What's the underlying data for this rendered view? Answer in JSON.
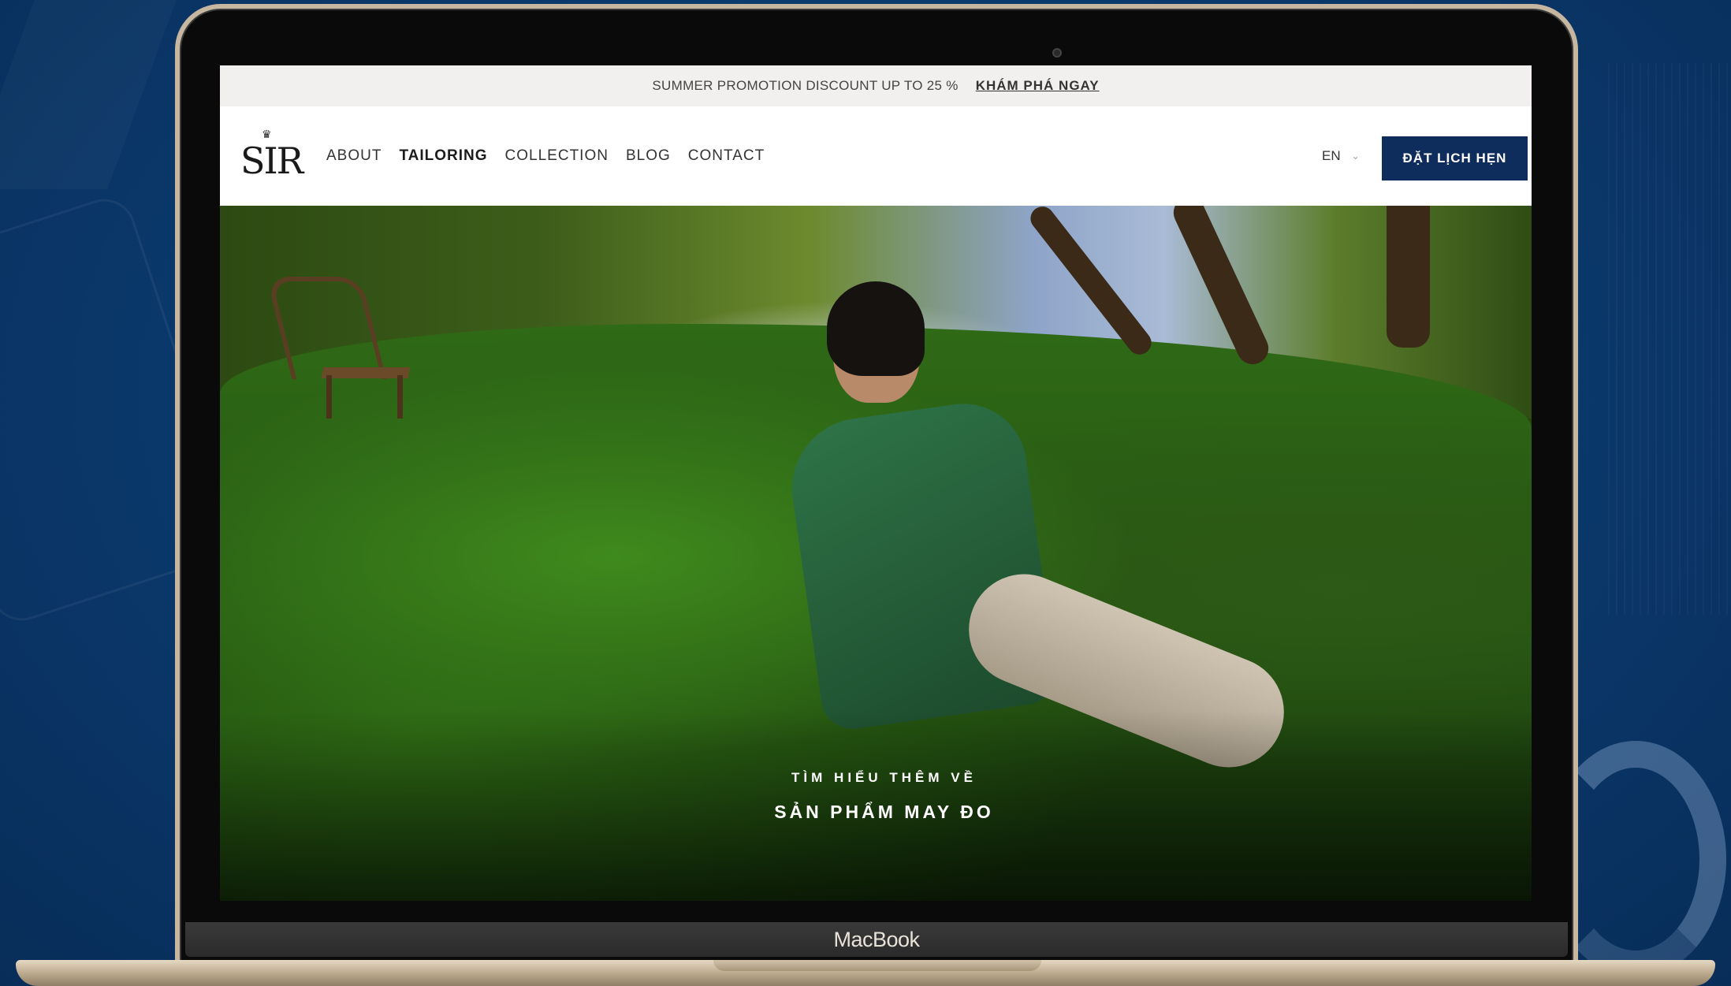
{
  "device_label": "MacBook",
  "promo": {
    "text": "SUMMER PROMOTION DISCOUNT UP TO 25 %",
    "link": "KHÁM PHÁ NGAY"
  },
  "header": {
    "logo_text": "SIR",
    "nav": [
      {
        "label": "ABOUT",
        "active": false
      },
      {
        "label": "TAILORING",
        "active": true
      },
      {
        "label": "COLLECTION",
        "active": false
      },
      {
        "label": "BLOG",
        "active": false
      },
      {
        "label": "CONTACT",
        "active": false
      }
    ],
    "language": "EN",
    "cta": "ĐẶT LỊCH HẸN"
  },
  "hero": {
    "kicker": "TÌM HIỂU THÊM VỀ",
    "title": "SẢN PHẨM MAY ĐO"
  },
  "colors": {
    "background": "#0b3b70",
    "cta_bg": "#0e2c5c",
    "promo_bg": "#f2f0ee"
  }
}
